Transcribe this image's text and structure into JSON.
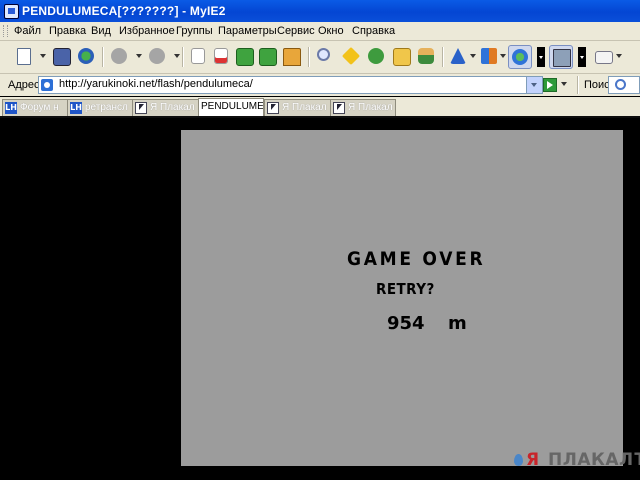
{
  "window": {
    "title": "PENDULUMECA[???????] - MyIE2"
  },
  "menubar": {
    "items": [
      "Файл",
      "Правка",
      "Вид",
      "Избранное",
      "Группы",
      "Параметры",
      "Сервис",
      "Окно",
      "Справка"
    ]
  },
  "toolbar": {
    "icons": [
      "new-page-icon",
      "save-icon",
      "connect-icon",
      "back-icon",
      "forward-icon",
      "stop-icon",
      "close-all-icon",
      "refresh-icon",
      "refresh-all-icon",
      "home-icon",
      "search-icon",
      "favorites-icon",
      "history-icon",
      "open-folder-icon",
      "user-icon",
      "text-size-icon",
      "translate-icon",
      "globe-icon",
      "image-toggle-icon",
      "mail-icon"
    ]
  },
  "addressbar": {
    "label": "Адрес",
    "url": "http://yarukinoki.net/flash/pendulumeca/",
    "search_label": "Поиск"
  },
  "tabs": [
    {
      "label": "Форум н",
      "icon": "lh",
      "active": false
    },
    {
      "label": "ретрансл",
      "icon": "lh",
      "active": false
    },
    {
      "label": "Я Плакал",
      "icon": "arrow",
      "active": false
    },
    {
      "label": "PENDULUME...",
      "icon": "none",
      "active": true
    },
    {
      "label": "Я Плакал",
      "icon": "arrow",
      "active": false
    },
    {
      "label": "Я Плакал",
      "icon": "arrow",
      "active": false
    }
  ],
  "game": {
    "game_over": "GAME OVER",
    "retry": "RETRY?",
    "distance": "954",
    "unit": "m",
    "background": "#9c9c9c"
  },
  "watermark": {
    "text_ya": "Я",
    "text_rest": "ПЛАКАЛЪ"
  },
  "colors": {
    "titlebar": "#0446d3",
    "chrome": "#ece9d8",
    "content_bg": "#000000"
  }
}
